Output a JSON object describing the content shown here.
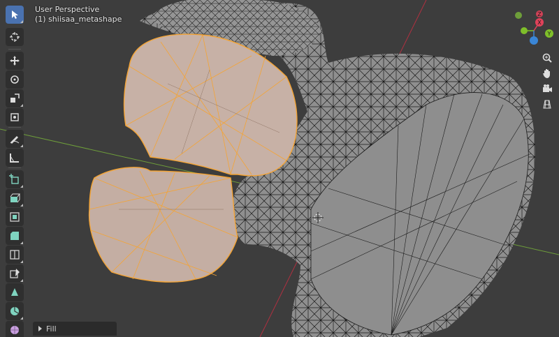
{
  "viewport": {
    "view_title": "User Perspective",
    "object_name": "(1) shiisaa_metashape"
  },
  "gizmo": {
    "axis_z_label": "Z",
    "axis_y_label": "Y",
    "axis_x_label": "X",
    "colors": {
      "x": "#e0425a",
      "y": "#7fbf2a",
      "z": "#3a86d6"
    }
  },
  "toolbar": {
    "tools": [
      "select-box",
      "cursor",
      "move",
      "rotate",
      "scale",
      "transform",
      "annotate",
      "measure",
      "add-cube",
      "extrude",
      "inset",
      "bevel",
      "loop-cut",
      "knife",
      "poly-build",
      "spin",
      "smooth"
    ]
  },
  "navigation": {
    "buttons": [
      "zoom",
      "pan",
      "camera",
      "perspective-toggle"
    ]
  },
  "operator_panel": {
    "label": "Fill"
  },
  "colors": {
    "background": "#3d3d3d",
    "selection": "#f4a435",
    "mesh": "#8a8a8a"
  }
}
